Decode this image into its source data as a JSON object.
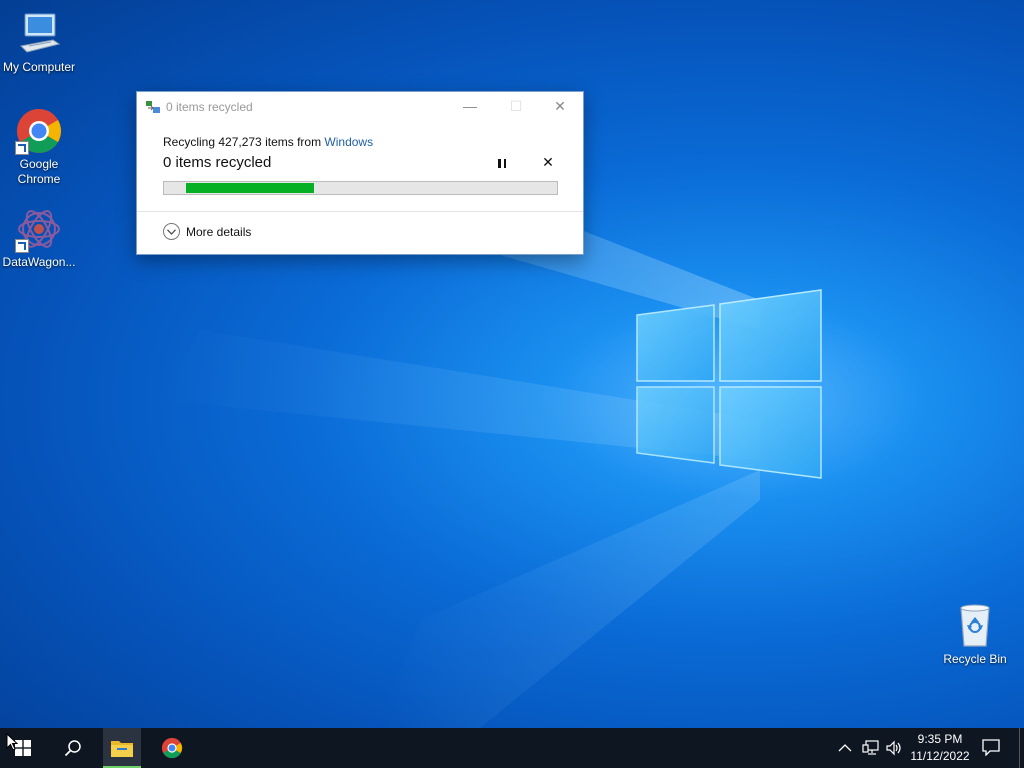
{
  "desktop": {
    "icons": [
      {
        "label": "My Computer"
      },
      {
        "label": "Google Chrome"
      },
      {
        "label": "DataWagon..."
      },
      {
        "label": "Recycle Bin"
      }
    ]
  },
  "dialog": {
    "title": "0 items recycled",
    "line1_prefix": "Recycling 427,273 items from ",
    "line1_link": "Windows",
    "status": "0 items recycled",
    "progress_percent": 32,
    "more_details": "More details",
    "minimize_glyph": "—",
    "maximize_glyph": "☐",
    "close_glyph": "✕",
    "cancel_glyph": "✕"
  },
  "taskbar": {
    "clock_time": "9:35 PM",
    "clock_date": "11/12/2022",
    "icons": [
      "windows-start-icon",
      "search-icon",
      "file-explorer-icon",
      "chrome-icon",
      "chevron-up-icon",
      "network-icon",
      "volume-icon",
      "notification-icon"
    ]
  },
  "colors": {
    "progress_fill": "#06b025",
    "link": "#1f5fa6",
    "taskbar": "#0e1621"
  }
}
